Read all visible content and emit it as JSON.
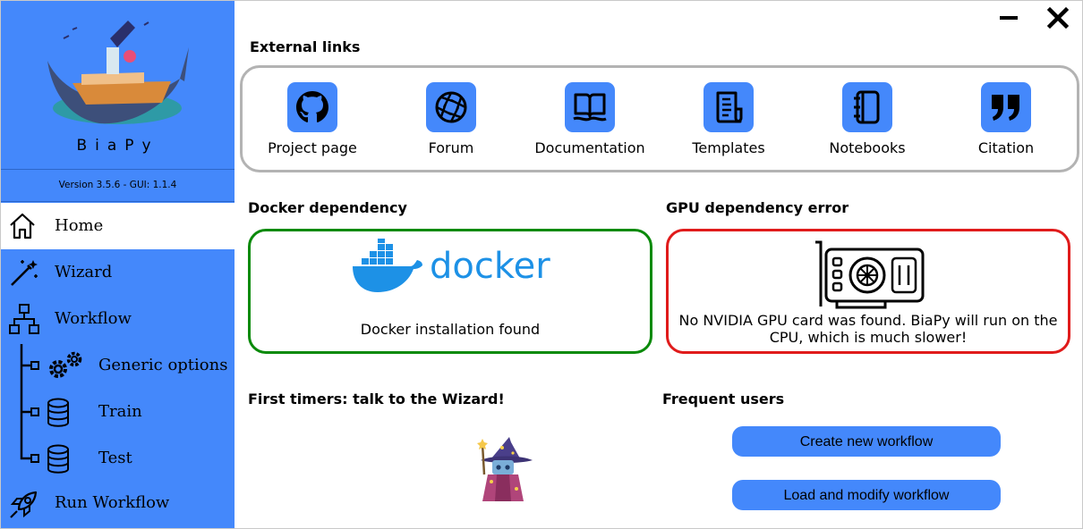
{
  "sidebar": {
    "brand": "BiaPy",
    "version": "Version 3.5.6 - GUI: 1.1.4",
    "items": [
      {
        "label": "Home",
        "icon": "home-icon",
        "active": true
      },
      {
        "label": "Wizard",
        "icon": "magic-wand-icon"
      },
      {
        "label": "Workflow",
        "icon": "workflow-icon"
      },
      {
        "label": "Generic options",
        "icon": "gears-icon"
      },
      {
        "label": "Train",
        "icon": "database-icon"
      },
      {
        "label": "Test",
        "icon": "database-icon"
      },
      {
        "label": "Run Workflow",
        "icon": "rocket-icon"
      }
    ]
  },
  "window": {
    "minimize_icon": "minimize-icon",
    "close_icon": "close-icon"
  },
  "external_links": {
    "title": "External links",
    "items": [
      {
        "label": "Project page",
        "icon": "github-icon"
      },
      {
        "label": "Forum",
        "icon": "forum-icon"
      },
      {
        "label": "Documentation",
        "icon": "book-icon"
      },
      {
        "label": "Templates",
        "icon": "templates-icon"
      },
      {
        "label": "Notebooks",
        "icon": "notebook-icon"
      },
      {
        "label": "Citation",
        "icon": "quote-icon"
      }
    ]
  },
  "docker": {
    "title": "Docker dependency",
    "logo_text": "docker",
    "message": "Docker installation found",
    "border_color": "#0a8a0a"
  },
  "gpu": {
    "title": "GPU dependency error",
    "message": "No NVIDIA GPU card was found. BiaPy will run on the CPU, which is much slower!",
    "border_color": "#e01b1b"
  },
  "first_timers": {
    "title": "First timers: talk to the Wizard!"
  },
  "frequent_users": {
    "title": "Frequent users",
    "create_label": "Create new workflow",
    "load_label": "Load and modify workflow"
  },
  "colors": {
    "accent": "#4488fb",
    "docker_blue": "#1d91e6"
  }
}
